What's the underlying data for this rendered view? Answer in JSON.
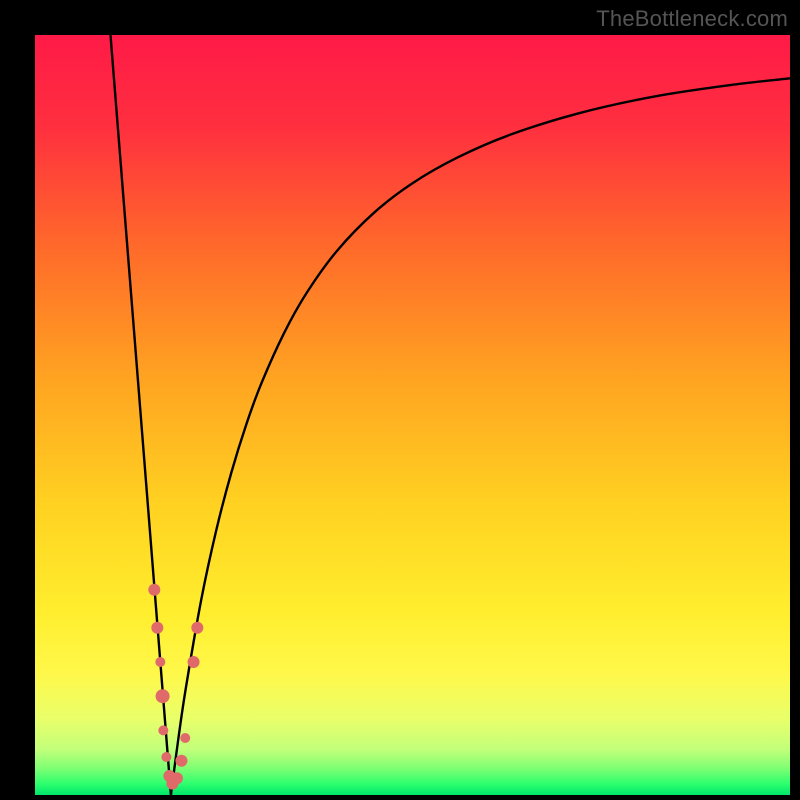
{
  "watermark": "TheBottleneck.com",
  "colors": {
    "gradient_stops": [
      {
        "offset": 0.0,
        "color": "#ff1a47"
      },
      {
        "offset": 0.12,
        "color": "#ff2f3f"
      },
      {
        "offset": 0.28,
        "color": "#ff6a2a"
      },
      {
        "offset": 0.45,
        "color": "#ffa321"
      },
      {
        "offset": 0.62,
        "color": "#ffd221"
      },
      {
        "offset": 0.76,
        "color": "#ffee2e"
      },
      {
        "offset": 0.84,
        "color": "#fff84a"
      },
      {
        "offset": 0.9,
        "color": "#e9ff6a"
      },
      {
        "offset": 0.94,
        "color": "#c2ff7a"
      },
      {
        "offset": 0.965,
        "color": "#7eff73"
      },
      {
        "offset": 0.985,
        "color": "#2eff6e"
      },
      {
        "offset": 1.0,
        "color": "#00e56b"
      }
    ],
    "curve": "#000000",
    "marker_fill": "#e06a6a",
    "marker_stroke": "#c85454",
    "black": "#000000"
  },
  "chart_data": {
    "type": "line",
    "title": "",
    "xlabel": "",
    "ylabel": "",
    "xlim": [
      0,
      100
    ],
    "ylim": [
      0,
      100
    ],
    "x_optimum": 18,
    "series": [
      {
        "name": "left-branch",
        "x": [
          10.0,
          11.0,
          12.0,
          13.0,
          14.0,
          15.0,
          16.0,
          17.0,
          18.0
        ],
        "y": [
          100.0,
          87.5,
          75.0,
          62.5,
          50.0,
          37.5,
          25.0,
          12.5,
          0.0
        ]
      },
      {
        "name": "right-branch",
        "x": [
          18,
          19,
          20,
          22,
          24,
          26,
          28,
          30,
          33,
          36,
          40,
          45,
          50,
          56,
          63,
          72,
          82,
          92,
          100
        ],
        "y": [
          0.0,
          7.5,
          14.2,
          25.6,
          34.8,
          42.4,
          48.8,
          54.2,
          60.8,
          66.1,
          71.6,
          76.7,
          80.5,
          83.9,
          86.9,
          89.7,
          91.9,
          93.4,
          94.3
        ]
      }
    ],
    "markers": {
      "name": "data-points",
      "points": [
        {
          "x": 15.8,
          "y": 27.0,
          "r": 6
        },
        {
          "x": 16.2,
          "y": 22.0,
          "r": 6
        },
        {
          "x": 16.6,
          "y": 17.5,
          "r": 5
        },
        {
          "x": 16.9,
          "y": 13.0,
          "r": 7
        },
        {
          "x": 17.0,
          "y": 8.5,
          "r": 5
        },
        {
          "x": 17.4,
          "y": 5.0,
          "r": 5
        },
        {
          "x": 17.8,
          "y": 2.5,
          "r": 6
        },
        {
          "x": 18.2,
          "y": 1.5,
          "r": 6
        },
        {
          "x": 18.8,
          "y": 2.2,
          "r": 6
        },
        {
          "x": 19.4,
          "y": 4.5,
          "r": 6
        },
        {
          "x": 19.9,
          "y": 7.5,
          "r": 5
        },
        {
          "x": 21.0,
          "y": 17.5,
          "r": 6
        },
        {
          "x": 21.5,
          "y": 22.0,
          "r": 6
        }
      ]
    }
  }
}
